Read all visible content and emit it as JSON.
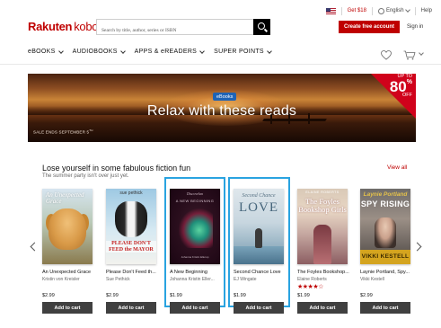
{
  "topbar": {
    "credit": "Get $18",
    "language": "English",
    "help": "Help"
  },
  "header": {
    "logo_brand": "Rakuten",
    "logo_product": "kobo",
    "search_placeholder": "Search by title, author, series or ISBN",
    "create_account": "Create free account",
    "sign_in": "Sign in"
  },
  "nav": {
    "items": [
      {
        "label": "eBOOKS"
      },
      {
        "label": "AUDIOBOOKS"
      },
      {
        "label": "APPS & eREADERS"
      },
      {
        "label": "SUPER POINTS"
      }
    ]
  },
  "banner": {
    "badge": "eBooks",
    "headline": "Relax with these reads",
    "sale_ends": "SALE ENDS SEPTEMBER 5",
    "sale_ends_suffix": "TH",
    "promo_up_to": "UP TO",
    "promo_value": "80",
    "promo_pct": "%",
    "promo_off": "OFF"
  },
  "section": {
    "title": "Lose yourself in some fabulous fiction fun",
    "subtitle": "The summer party isn't over just yet.",
    "view_all": "View all"
  },
  "books": [
    {
      "title": "An Unexpected Grace",
      "author": "Kristin von Kreisler",
      "price": "$2.99",
      "cover_text": "An Unexpected Grace",
      "stars": ""
    },
    {
      "title": "Please Don't Feed th...",
      "author": "Sue Pethick",
      "price": "$2.99",
      "cover_author": "sue pethick",
      "cover_text": "PLEASE DON'T FEED the MAYOR",
      "stars": ""
    },
    {
      "title": "A New Beginning",
      "author": "Johanna Kristin Eller...",
      "price": "$1.99",
      "cover_top": "Discovelan",
      "cover_text": "A NEW BEGINNING",
      "cover_author": "Johanna Kristin Ellerup",
      "stars": ""
    },
    {
      "title": "Second Chance Love",
      "author": "EJ Wingate",
      "price": "$1.99",
      "cover_text_1": "Second Chance",
      "cover_text_2": "LOVE",
      "stars": ""
    },
    {
      "title": "The Foyles Bookshop...",
      "author": "Elaine Roberts",
      "price": "$1.99",
      "cover_author": "ELAINE ROBERTS",
      "cover_text": "The Foyles Bookshop Girls",
      "stars": "★★★★☆",
      "rating": 4
    },
    {
      "title": "Laynie Portland, Spy...",
      "author": "Vikki Kestell",
      "price": "$2.99",
      "cover_text_1": "Laynie Portland",
      "cover_text_2": "SPY RISING",
      "cover_author": "VIKKI KESTELL",
      "stars": ""
    }
  ],
  "add_to_cart_label": "Add to cart",
  "colors": {
    "brand_red": "#bf0000",
    "highlight_blue": "#29a3e0",
    "button_dark": "#404040",
    "promo_red": "#d0021b",
    "badge_blue": "#1e63b5"
  }
}
